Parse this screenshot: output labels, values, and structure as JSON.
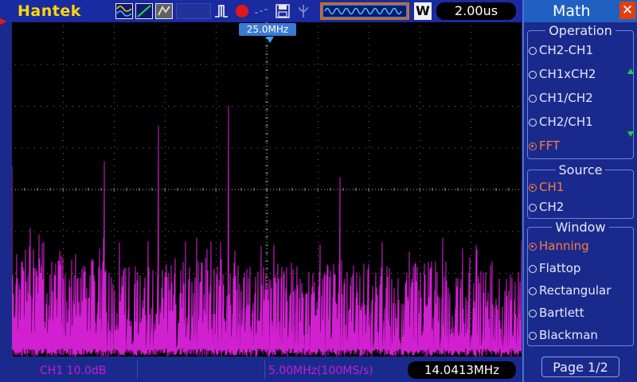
{
  "header": {
    "brand": "Hantek",
    "timebase": "2.00us",
    "time_mode_label": "W",
    "icons": [
      "math-wave-icon",
      "cursor-icon",
      "persist-icon",
      "trigger-edge-icon",
      "record-icon",
      "wifi-icon",
      "save-icon",
      "usb-icon"
    ],
    "colors": {
      "brand": "#ffd800",
      "trace": "#d020d0",
      "panel_accent": "#2060c0",
      "selected": "#ff7a40"
    }
  },
  "scope": {
    "freq_marker": "25.0MHz",
    "trace_color": "#d020d0"
  },
  "status": {
    "channel_scale": "CH1 10.0dB",
    "span": "5.00MHz(100MS/s)",
    "cursor_freq": "14.0413MHz"
  },
  "panel": {
    "title": "Math",
    "operation_title": "Operation",
    "operations": [
      {
        "label": "CH2-CH1",
        "selected": false
      },
      {
        "label": "CH1xCH2",
        "selected": false
      },
      {
        "label": "CH1/CH2",
        "selected": false
      },
      {
        "label": "CH2/CH1",
        "selected": false
      },
      {
        "label": "FFT",
        "selected": true
      }
    ],
    "source_title": "Source",
    "sources": [
      {
        "label": "CH1",
        "selected": true
      },
      {
        "label": "CH2",
        "selected": false
      }
    ],
    "window_title": "Window",
    "windows": [
      {
        "label": "Hanning",
        "selected": true
      },
      {
        "label": "Flattop",
        "selected": false
      },
      {
        "label": "Rectangular",
        "selected": false
      },
      {
        "label": "Bartlett",
        "selected": false
      },
      {
        "label": "Blackman",
        "selected": false
      }
    ],
    "page": "Page 1/2"
  }
}
